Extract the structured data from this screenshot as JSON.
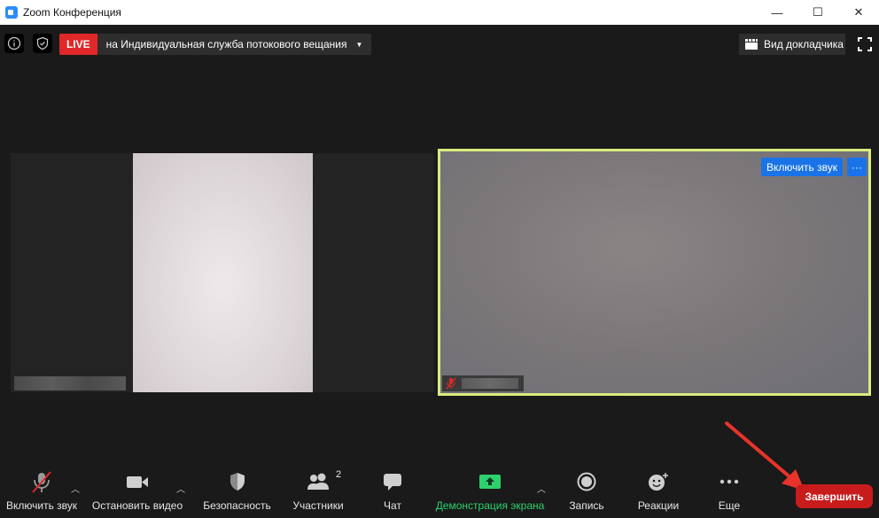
{
  "window": {
    "title": "Zoom Конференция",
    "controls": {
      "minimize": "—",
      "maximize": "☐",
      "close": "✕"
    }
  },
  "top_bar": {
    "live_badge": "LIVE",
    "live_destination": "на Индивидуальная служба потокового вещания",
    "speaker_view": "Вид докладчика"
  },
  "participants": {
    "right_tile": {
      "unmute_label": "Включить звук",
      "more_label": "···"
    }
  },
  "toolbar": {
    "unmute": "Включить звук",
    "stop_video": "Остановить видео",
    "security": "Безопасность",
    "participants": "Участники",
    "participants_count": "2",
    "chat": "Чат",
    "share_screen": "Демонстрация экрана",
    "record": "Запись",
    "reactions": "Реакции",
    "more": "Еще",
    "end": "Завершить"
  },
  "colors": {
    "live": "#e02828",
    "accent_blue": "#1a73e8",
    "share_green": "#2dd16e",
    "end_red": "#c81c1c",
    "active_speaker_border": "#d9ec7e"
  }
}
